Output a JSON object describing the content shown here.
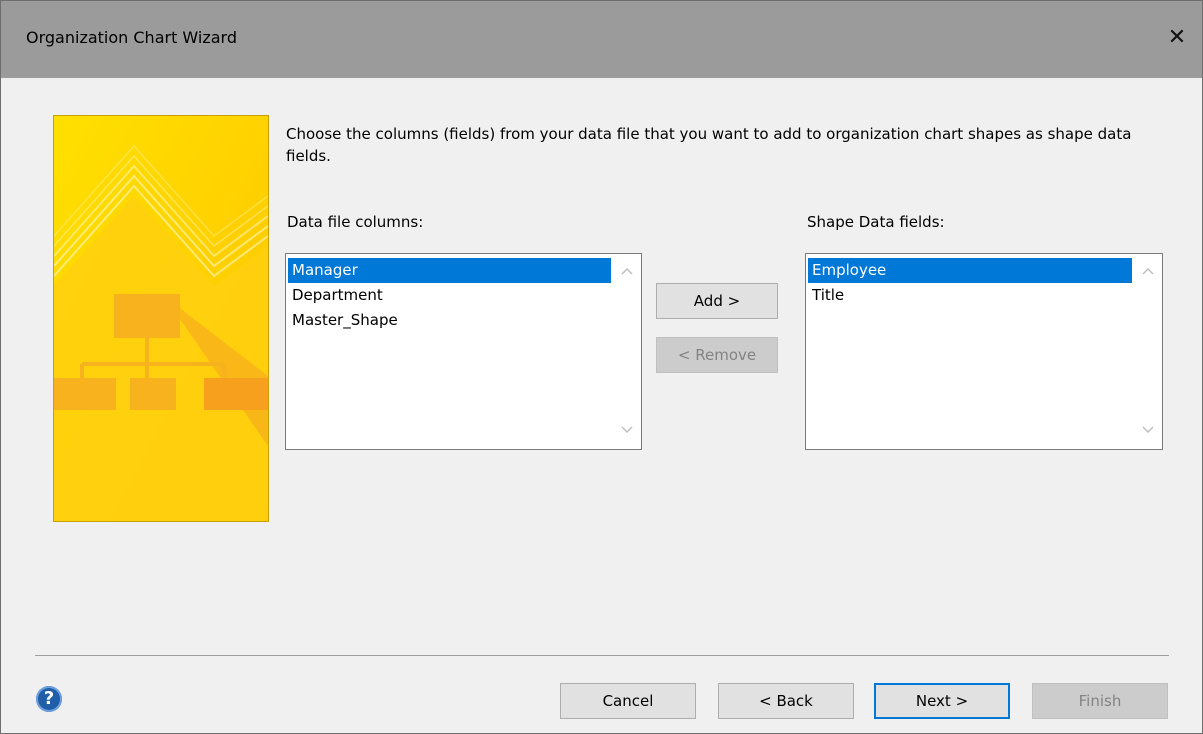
{
  "window": {
    "title": "Organization Chart Wizard",
    "close_glyph": "✕"
  },
  "instruction": "Choose the columns (fields) from your data file that you want to add to organization chart shapes as shape data fields.",
  "left_list": {
    "label": "Data file columns:",
    "items": [
      "Manager",
      "Department",
      "Master_Shape"
    ],
    "selected": "Manager"
  },
  "right_list": {
    "label": "Shape Data fields:",
    "items": [
      "Employee",
      "Title"
    ],
    "selected": "Employee"
  },
  "buttons": {
    "add": "Add >",
    "remove": "< Remove",
    "cancel": "Cancel",
    "back": "< Back",
    "next": "Next >",
    "finish": "Finish"
  },
  "icons": {
    "help": "?",
    "scroll_up": "^",
    "scroll_down": "v"
  },
  "colors": {
    "titlebar": "#9b9b9b",
    "selection": "#0078d7",
    "graphic_yellow": "#ffd400",
    "graphic_orange": "#f6a623"
  }
}
